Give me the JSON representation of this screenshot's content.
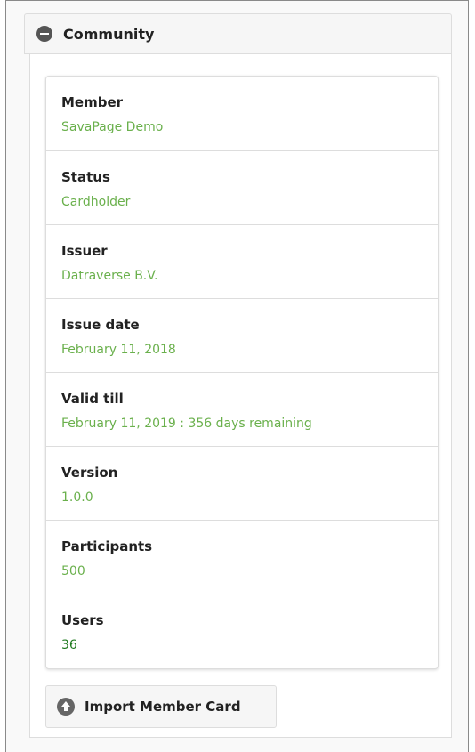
{
  "community": {
    "header_title": "Community",
    "items": [
      {
        "label": "Member",
        "value": "SavaPage Demo"
      },
      {
        "label": "Status",
        "value": "Cardholder"
      },
      {
        "label": "Issuer",
        "value": "Datraverse B.V."
      },
      {
        "label": "Issue date",
        "value": "February 11, 2018"
      },
      {
        "label": "Valid till",
        "value": "February 11, 2019 : 356 days remaining"
      },
      {
        "label": "Version",
        "value": "1.0.0"
      },
      {
        "label": "Participants",
        "value": "500"
      },
      {
        "label": "Users",
        "value": "36"
      }
    ],
    "import_button_label": "Import Member Card"
  },
  "colors": {
    "value_text": "#6ab04c",
    "users_value_text": "#1f7a1f",
    "header_background": "#f6f6f6"
  },
  "icons": {
    "header": "minus-circle-icon",
    "import_button": "arrow-up-circle-icon"
  }
}
